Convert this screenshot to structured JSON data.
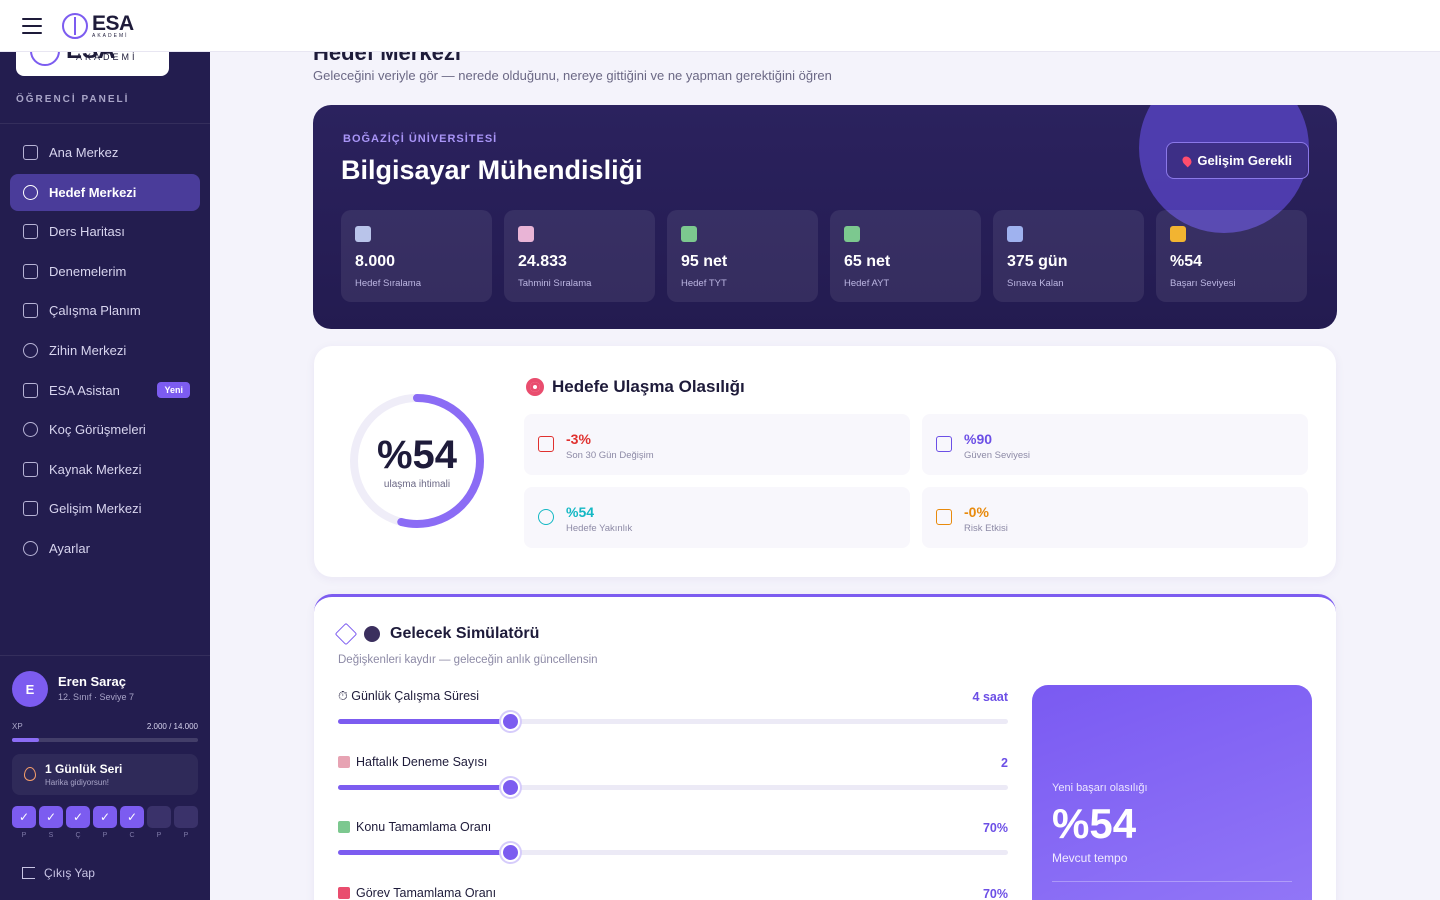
{
  "topbar": {
    "brand": "ESA",
    "brand_sub": "AKADEMİ"
  },
  "sidebar": {
    "brand": "ESA",
    "brand_sub": "AKADEMİ",
    "section_label": "ÖĞRENCİ PANELİ",
    "items": [
      {
        "label": "Ana Merkez",
        "icon": "home-icon"
      },
      {
        "label": "Hedef Merkezi",
        "icon": "target-icon",
        "active": true
      },
      {
        "label": "Ders Haritası",
        "icon": "book-open-icon"
      },
      {
        "label": "Denemelerim",
        "icon": "document-icon"
      },
      {
        "label": "Çalışma Planım",
        "icon": "calendar-icon"
      },
      {
        "label": "Zihin Merkezi",
        "icon": "brain-icon"
      },
      {
        "label": "ESA Asistan",
        "icon": "bot-icon",
        "badge": "Yeni"
      },
      {
        "label": "Koç Görüşmeleri",
        "icon": "users-icon"
      },
      {
        "label": "Kaynak Merkezi",
        "icon": "library-icon"
      },
      {
        "label": "Gelişim Merkezi",
        "icon": "trending-up-icon"
      },
      {
        "label": "Ayarlar",
        "icon": "gear-icon"
      }
    ],
    "user": {
      "initial": "E",
      "name": "Eren Saraç",
      "meta": "12. Sınıf · Seviye 7",
      "xp_label": "XP",
      "xp_value": "2.000 / 14.000",
      "xp_fraction": 0.143
    },
    "streak": {
      "title": "1 Günlük Seri",
      "subtitle": "Harika gidiyorsun!"
    },
    "days": [
      {
        "label": "P",
        "done": true,
        "mark": "✓"
      },
      {
        "label": "S",
        "done": true,
        "mark": "✓"
      },
      {
        "label": "Ç",
        "done": true,
        "mark": "✓"
      },
      {
        "label": "P",
        "done": true,
        "mark": "✓"
      },
      {
        "label": "C",
        "done": true,
        "mark": "✓"
      },
      {
        "label": "P",
        "done": false,
        "mark": ""
      },
      {
        "label": "P",
        "done": false,
        "mark": ""
      }
    ],
    "logout": "Çıkış Yap"
  },
  "main": {
    "title": "Hedef Merkezi",
    "subtitle": "Geleceğini veriyle gör — nerede olduğunu, nereye gittiğini ve ne yapman gerektiğini öğren",
    "hero": {
      "university": "BOĞAZİÇİ ÜNİVERSİTESİ",
      "department": "Bilgisayar Mühendisliği",
      "status_button": "Gelişim Gerekli",
      "stats": [
        {
          "value": "8.000",
          "label": "Hedef Sıralama",
          "icon": "chart-up-icon",
          "color": "#b9c4ea"
        },
        {
          "value": "24.833",
          "label": "Tahmini Sıralama",
          "icon": "bar-chart-icon",
          "color": "#e9b4d6"
        },
        {
          "value": "95 net",
          "label": "Hedef TYT",
          "icon": "books-icon",
          "color": "#7cc88f"
        },
        {
          "value": "65 net",
          "label": "Hedef AYT",
          "icon": "books-icon",
          "color": "#7cc88f"
        },
        {
          "value": "375 gün",
          "label": "Sınava Kalan",
          "icon": "calendar-icon",
          "color": "#9fb2ef"
        },
        {
          "value": "%54",
          "label": "Başarı Seviyesi",
          "icon": "trophy-icon",
          "color": "#f2b431"
        }
      ]
    },
    "probability": {
      "title": "Hedefe Ulaşma Olasılığı",
      "value_text": "%54",
      "value_fraction": 0.54,
      "value_label": "ulaşma ihtimali",
      "metrics": [
        {
          "value": "-3%",
          "label": "Son 30 Gün Değişim",
          "color": "#e0312f",
          "icon": "trend-down-icon"
        },
        {
          "value": "%90",
          "label": "Güven Seviyesi",
          "color": "#6c4fe6",
          "icon": "shield-icon"
        },
        {
          "value": "%54",
          "label": "Hedefe Yakınlık",
          "color": "#14b8c4",
          "icon": "target-icon"
        },
        {
          "value": "-0%",
          "label": "Risk Etkisi",
          "color": "#e88a0c",
          "icon": "warning-icon"
        }
      ]
    },
    "simulator": {
      "title": "Gelecek Simülatörü",
      "subtitle": "Değişkenleri kaydır — geleceğin anlık güncellensin",
      "sliders": [
        {
          "label": "⏱ Günlük Çalışma Süresi",
          "value": "4 saat",
          "fraction": 0.257
        },
        {
          "label": "Haftalık Deneme Sayısı",
          "value": "2",
          "fraction": 0.257
        },
        {
          "label": "Konu Tamamlama Oranı",
          "value": "70%",
          "fraction": 0.257
        },
        {
          "label": "Görev Tamamlama Oranı",
          "value": "70%",
          "fraction": 0.257
        }
      ],
      "result": {
        "label": "Yeni başarı olasılığı",
        "value": "%54",
        "tempo": "Mevcut tempo"
      }
    }
  }
}
